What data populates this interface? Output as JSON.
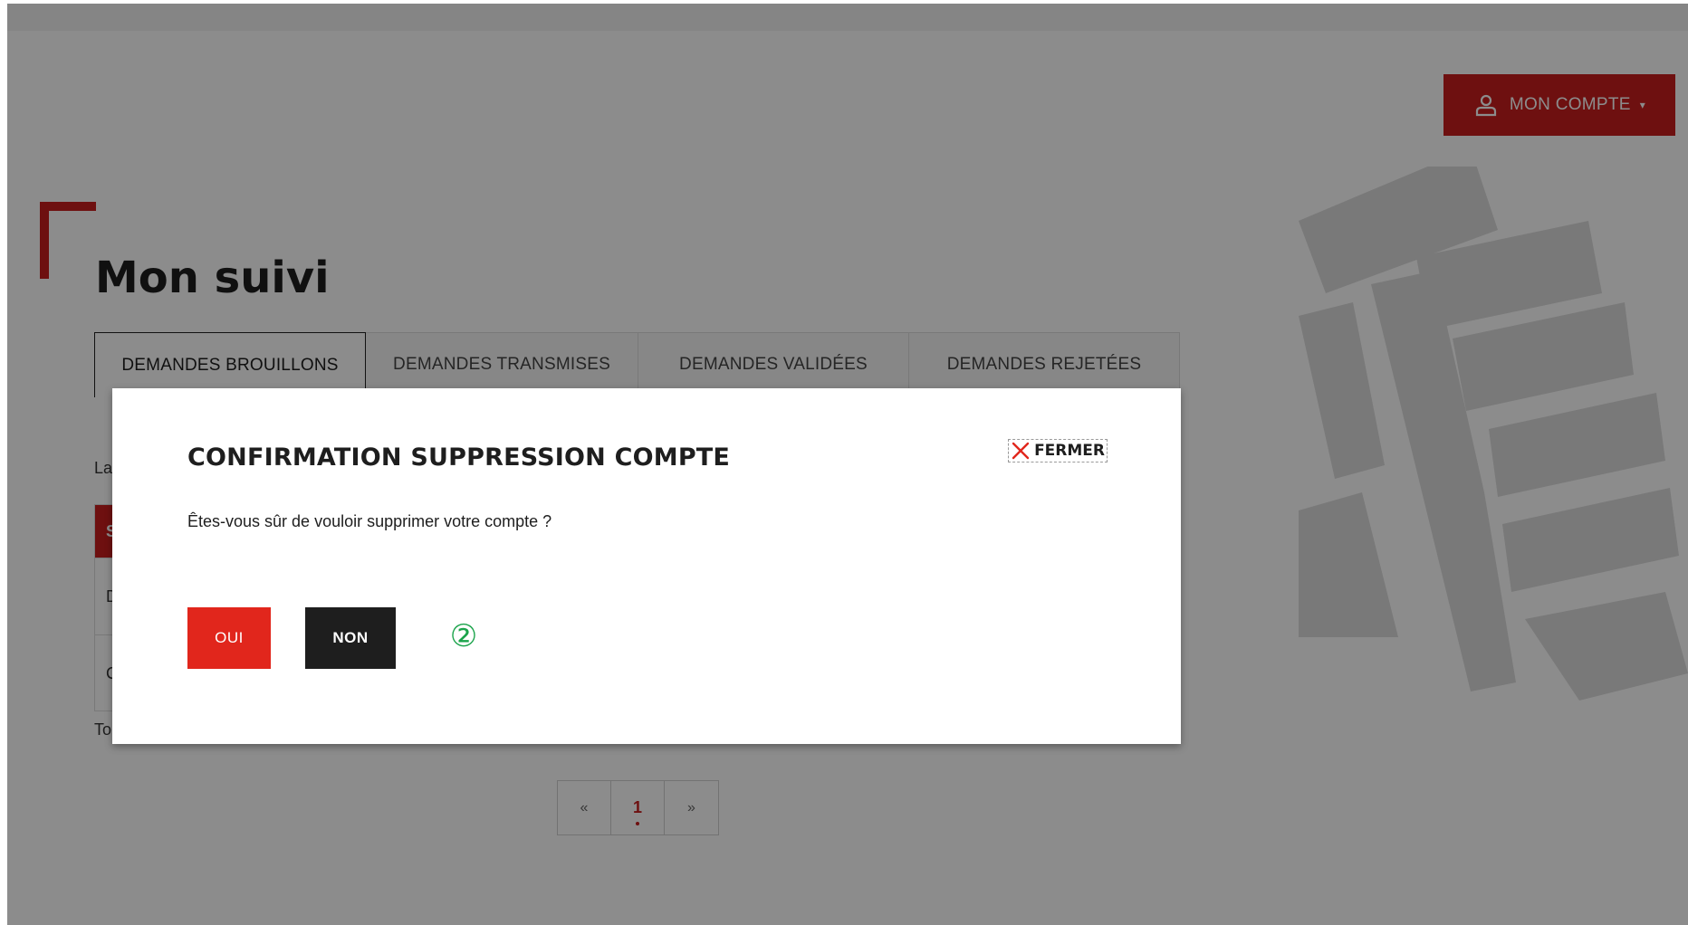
{
  "header": {
    "account_button_label": "MON COMPTE",
    "account_icon": "user-icon",
    "caret_icon": "chevron-down-icon"
  },
  "page": {
    "title": "Mon suivi"
  },
  "tabs": [
    {
      "label": "DEMANDES BROUILLONS",
      "active": true
    },
    {
      "label": "DEMANDES TRANSMISES",
      "active": false
    },
    {
      "label": "DEMANDES VALIDÉES",
      "active": false
    },
    {
      "label": "DEMANDES REJETÉES",
      "active": false
    }
  ],
  "behind": {
    "intro_text": "La",
    "table_header": "S",
    "rows": [
      "D",
      "C"
    ],
    "total_text": "To"
  },
  "pagination": {
    "prev": "«",
    "current": "1",
    "next": "»"
  },
  "modal": {
    "title": "CONFIRMATION SUPPRESSION COMPTE",
    "close_label": "FERMER",
    "close_icon": "close-icon",
    "message": "Êtes-vous sûr de vouloir supprimer votre compte ?",
    "confirm_label": "OUI",
    "cancel_label": "NON",
    "step_marker": "②"
  },
  "colors": {
    "brand_red": "#c81e1e",
    "confirm_red": "#e1261c",
    "cancel_dark": "#1e1e1e",
    "step_green": "#1aa34a"
  }
}
